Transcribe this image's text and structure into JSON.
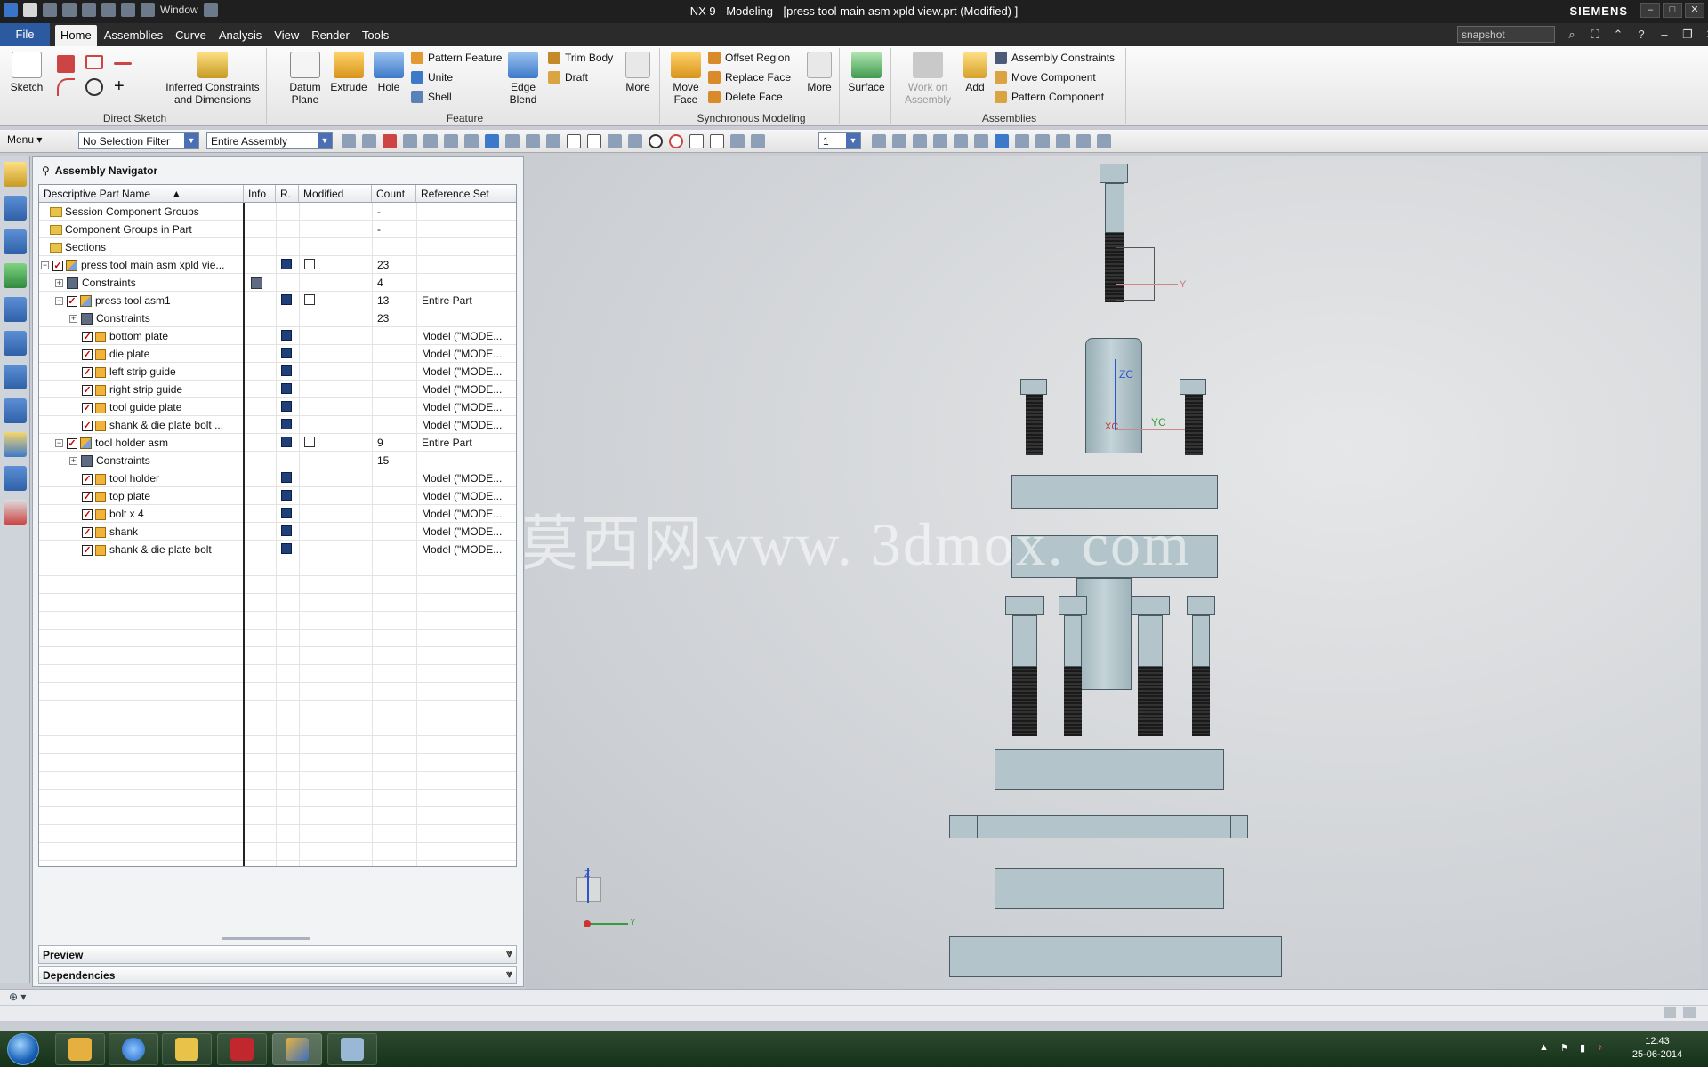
{
  "titlebar": {
    "title": "NX 9 - Modeling - [press tool main asm xpld view.prt (Modified) ]",
    "window_menu": "Window",
    "brand": "SIEMENS"
  },
  "menubar": {
    "file": "File",
    "tabs": [
      "Home",
      "Assemblies",
      "Curve",
      "Analysis",
      "View",
      "Render",
      "Tools"
    ],
    "search_placeholder": "snapshot"
  },
  "ribbon": {
    "direct_sketch": {
      "label": "Direct Sketch",
      "sketch": "Sketch",
      "inferred": "Inferred Constraints and Dimensions"
    },
    "feature": {
      "label": "Feature",
      "datum_plane": "Datum Plane",
      "extrude": "Extrude",
      "hole": "Hole",
      "pattern_feature": "Pattern Feature",
      "unite": "Unite",
      "shell": "Shell",
      "edge_blend": "Edge Blend",
      "trim_body": "Trim Body",
      "draft": "Draft",
      "more": "More"
    },
    "sync": {
      "label": "Synchronous Modeling",
      "move_face": "Move Face",
      "offset_region": "Offset Region",
      "replace_face": "Replace Face",
      "delete_face": "Delete Face",
      "more": "More"
    },
    "surface": {
      "label": "Surface"
    },
    "assemblies": {
      "label": "Assemblies",
      "work_on_assembly": "Work on Assembly",
      "add": "Add",
      "assembly_constraints": "Assembly Constraints",
      "move_component": "Move Component",
      "pattern_component": "Pattern Component"
    }
  },
  "toolbar2": {
    "menu": "Menu",
    "selection_filter": "No Selection Filter",
    "scope": "Entire Assembly",
    "layer": "1"
  },
  "navigator": {
    "title": "Assembly Navigator",
    "columns": [
      "Descriptive Part Name",
      "Info",
      "R.",
      "Modified",
      "Count",
      "Reference Set"
    ],
    "rows": [
      {
        "name": "Session Component Groups",
        "count": "-",
        "ref": ""
      },
      {
        "name": "Component Groups in Part",
        "count": "-",
        "ref": ""
      },
      {
        "name": "Sections",
        "count": "",
        "ref": ""
      },
      {
        "name": "press tool main asm xpld vie...",
        "count": "23",
        "ref": ""
      },
      {
        "name": "Constraints",
        "count": "4",
        "ref": ""
      },
      {
        "name": "press tool asm1",
        "count": "13",
        "ref": "Entire Part"
      },
      {
        "name": "Constraints",
        "count": "23",
        "ref": ""
      },
      {
        "name": "bottom plate",
        "count": "",
        "ref": "Model (\"MODE..."
      },
      {
        "name": "die plate",
        "count": "",
        "ref": "Model (\"MODE..."
      },
      {
        "name": "left strip guide",
        "count": "",
        "ref": "Model (\"MODE..."
      },
      {
        "name": "right strip guide",
        "count": "",
        "ref": "Model (\"MODE..."
      },
      {
        "name": "tool guide plate",
        "count": "",
        "ref": "Model (\"MODE..."
      },
      {
        "name": "shank & die plate bolt ...",
        "count": "",
        "ref": "Model (\"MODE..."
      },
      {
        "name": "tool holder asm",
        "count": "9",
        "ref": "Entire Part"
      },
      {
        "name": "Constraints",
        "count": "15",
        "ref": ""
      },
      {
        "name": "tool holder",
        "count": "",
        "ref": "Model (\"MODE..."
      },
      {
        "name": "top plate",
        "count": "",
        "ref": "Model (\"MODE..."
      },
      {
        "name": "bolt x 4",
        "count": "",
        "ref": "Model (\"MODE..."
      },
      {
        "name": "shank",
        "count": "",
        "ref": "Model (\"MODE..."
      },
      {
        "name": "shank & die plate bolt",
        "count": "",
        "ref": "Model (\"MODE..."
      }
    ],
    "preview": "Preview",
    "dependencies": "Dependencies"
  },
  "graphics": {
    "watermark": "莫西网www. 3dmox. com",
    "axis_labels": {
      "zc": "ZC",
      "yc": "YC",
      "xc": "XC",
      "y": "Y",
      "z": "Z"
    }
  },
  "taskbar": {
    "time": "12:43",
    "date": "25-06-2014"
  }
}
